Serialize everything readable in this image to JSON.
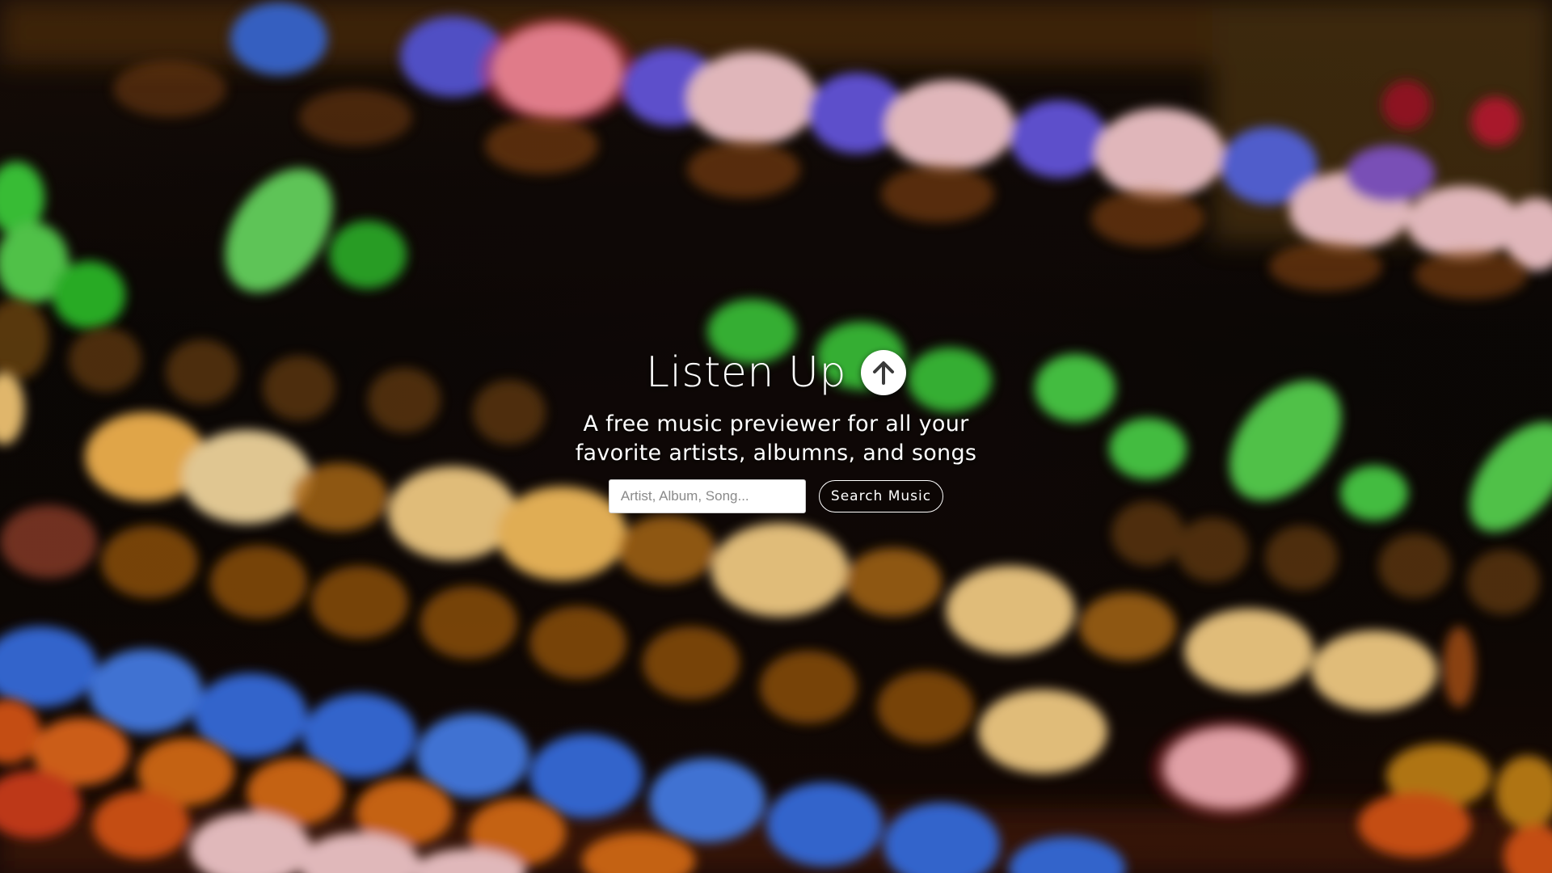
{
  "app": {
    "title": "Listen Up",
    "logo_icon": "arrow-up-circle-icon",
    "tagline_line1": "A free music previewer for all your",
    "tagline_line2": "favorite artists, albumns, and songs"
  },
  "search": {
    "placeholder": "Artist, Album, Song...",
    "value": "",
    "button_label": "Search Music"
  },
  "colors": {
    "logo_arrow": "#3a3a3a",
    "button_border": "#ffffff",
    "text": "#ffffff"
  }
}
